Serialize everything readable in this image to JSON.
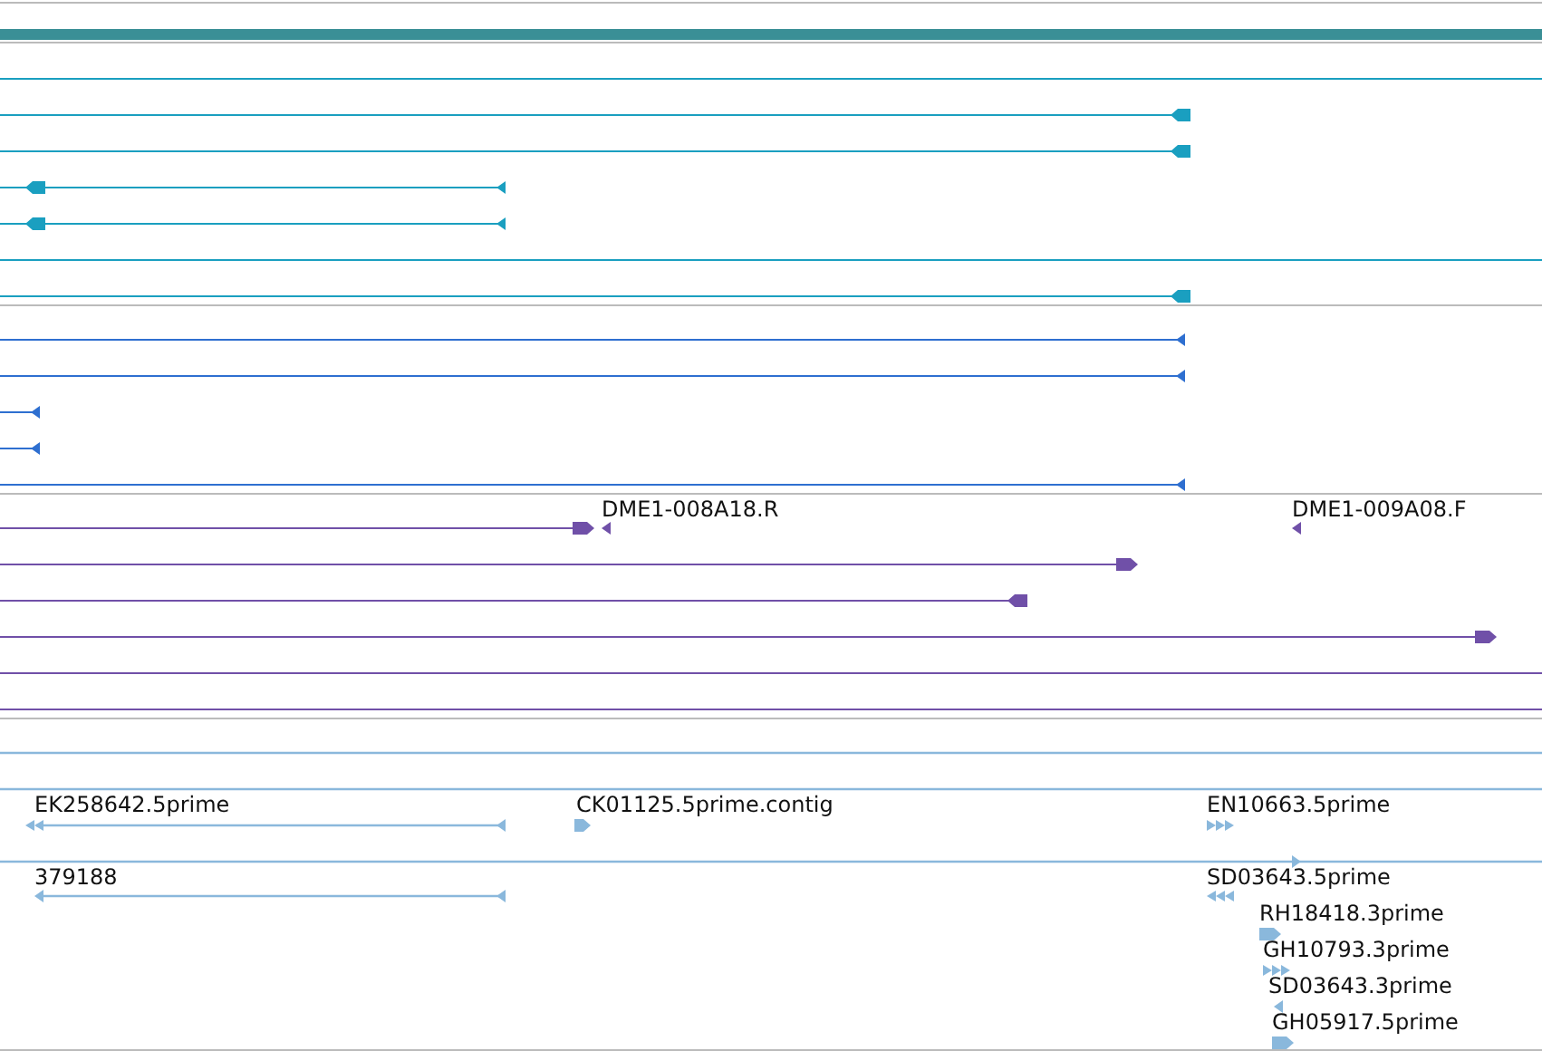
{
  "tracks": [
    {
      "kind": "alignment",
      "color": "#1a9fc0"
    },
    {
      "kind": "alignment",
      "color": "#2e6fd0"
    },
    {
      "kind": "alignment",
      "color": "#7050a8",
      "labels": [
        "DME1-008A18.R",
        "DME1-009A08.F"
      ]
    },
    {
      "kind": "est",
      "color": "#8ab8dc",
      "labels": [
        "EK258642.5prime",
        "CK01125.5prime.contig",
        "EN10663.5prime",
        "379188",
        "SD03643.5prime",
        "RH18418.3prime",
        "GH10793.3prime",
        "SD03643.3prime",
        "GH05917.5prime"
      ]
    }
  ]
}
